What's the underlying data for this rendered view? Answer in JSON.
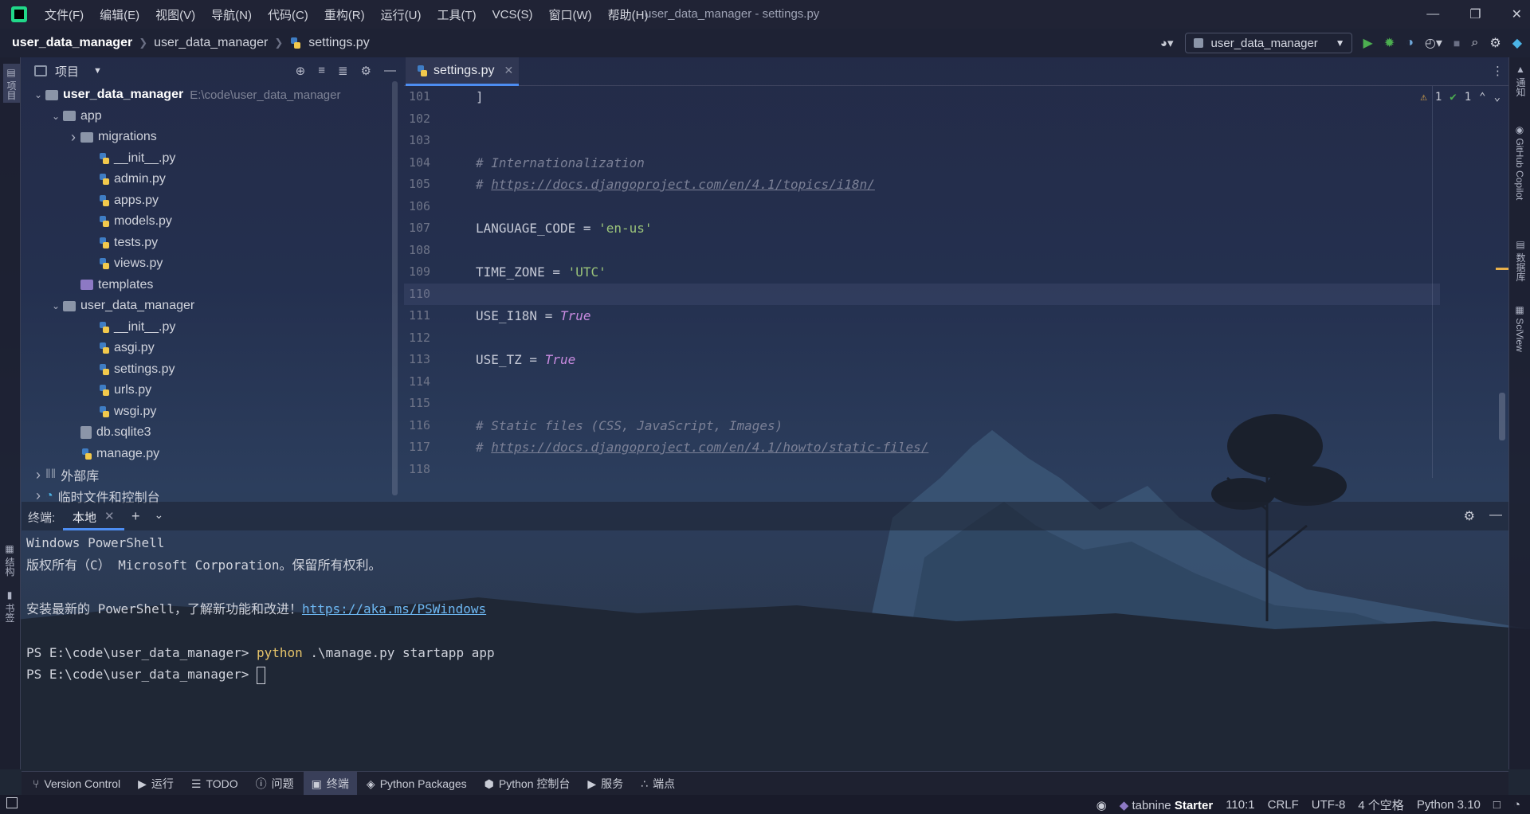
{
  "menu": [
    "文件(F)",
    "编辑(E)",
    "视图(V)",
    "导航(N)",
    "代码(C)",
    "重构(R)",
    "运行(U)",
    "工具(T)",
    "VCS(S)",
    "窗口(W)",
    "帮助(H)"
  ],
  "window_title": "user_data_manager - settings.py",
  "breadcrumb": {
    "root": "user_data_manager",
    "folder": "user_data_manager",
    "file": "settings.py"
  },
  "run_config": "user_data_manager",
  "left_stripe": {
    "project": "项目",
    "structure": "结构",
    "bookmarks": "书签"
  },
  "right_stripe": {
    "notifications": "通知",
    "copilot": "GitHub Copilot",
    "database": "数据库",
    "sciview": "SciView"
  },
  "project_panel": {
    "title": "项目",
    "tree": [
      {
        "level": 0,
        "arrow": "open",
        "icon": "folder",
        "label": "user_data_manager",
        "path": "E:\\code\\user_data_manager",
        "bold": true
      },
      {
        "level": 1,
        "arrow": "open",
        "icon": "folder",
        "label": "app"
      },
      {
        "level": 2,
        "arrow": "closed",
        "icon": "folder",
        "label": "migrations"
      },
      {
        "level": 3,
        "arrow": "none",
        "icon": "py",
        "label": "__init__.py"
      },
      {
        "level": 3,
        "arrow": "none",
        "icon": "py",
        "label": "admin.py"
      },
      {
        "level": 3,
        "arrow": "none",
        "icon": "py",
        "label": "apps.py"
      },
      {
        "level": 3,
        "arrow": "none",
        "icon": "py",
        "label": "models.py"
      },
      {
        "level": 3,
        "arrow": "none",
        "icon": "py",
        "label": "tests.py"
      },
      {
        "level": 3,
        "arrow": "none",
        "icon": "py",
        "label": "views.py"
      },
      {
        "level": 2,
        "arrow": "none",
        "icon": "folder-tpl",
        "label": "templates"
      },
      {
        "level": 1,
        "arrow": "open",
        "icon": "folder",
        "label": "user_data_manager"
      },
      {
        "level": 3,
        "arrow": "none",
        "icon": "py",
        "label": "__init__.py"
      },
      {
        "level": 3,
        "arrow": "none",
        "icon": "py",
        "label": "asgi.py"
      },
      {
        "level": 3,
        "arrow": "none",
        "icon": "py",
        "label": "settings.py"
      },
      {
        "level": 3,
        "arrow": "none",
        "icon": "py",
        "label": "urls.py"
      },
      {
        "level": 3,
        "arrow": "none",
        "icon": "py",
        "label": "wsgi.py"
      },
      {
        "level": 2,
        "arrow": "none",
        "icon": "db",
        "label": "db.sqlite3"
      },
      {
        "level": 2,
        "arrow": "none",
        "icon": "py",
        "label": "manage.py"
      },
      {
        "level": 0,
        "arrow": "closed",
        "icon": "lib",
        "label": "外部库"
      },
      {
        "level": 0,
        "arrow": "closed",
        "icon": "scratch",
        "label": "临时文件和控制台"
      }
    ]
  },
  "editor": {
    "tab": "settings.py",
    "inspections": {
      "warnings": "1",
      "weak_warnings": "1"
    },
    "line_numbers": [
      "101",
      "102",
      "103",
      "104",
      "105",
      "106",
      "107",
      "108",
      "109",
      "110",
      "111",
      "112",
      "113",
      "114",
      "115",
      "116",
      "117",
      "118"
    ],
    "lines": [
      "]",
      "",
      "",
      "# Internationalization",
      "# https://docs.djangoproject.com/en/4.1/topics/i18n/",
      "",
      "LANGUAGE_CODE = 'en-us'",
      "",
      "TIME_ZONE = 'UTC'",
      "",
      "USE_I18N = True",
      "",
      "USE_TZ = True",
      "",
      "",
      "# Static files (CSS, JavaScript, Images)",
      "# https://docs.djangoproject.com/en/4.1/howto/static-files/",
      ""
    ]
  },
  "terminal": {
    "label": "终端:",
    "tab": "本地",
    "lines": [
      "Windows PowerShell",
      "版权所有（C） Microsoft Corporation。保留所有权利。",
      "",
      "安装最新的 PowerShell，了解新功能和改进！",
      "",
      "PS E:\\code\\user_data_manager> ",
      "PS E:\\code\\user_data_manager> "
    ],
    "link": "https://aka.ms/PSWindows",
    "command_keyword": "python",
    "command_rest": " .\\manage.py startapp app"
  },
  "tool_windows": [
    "Version Control",
    "运行",
    "TODO",
    "问题",
    "终端",
    "Python Packages",
    "Python 控制台",
    "服务",
    "端点"
  ],
  "status": {
    "tabnine": "tabnine",
    "tabnine_plan": "Starter",
    "position": "110:1",
    "line_sep": "CRLF",
    "encoding": "UTF-8",
    "indent": "4 个空格",
    "interpreter": "Python 3.10"
  },
  "colors": {
    "accent": "#4d8df1",
    "run": "#4caf50",
    "warning": "#e8b04b"
  }
}
